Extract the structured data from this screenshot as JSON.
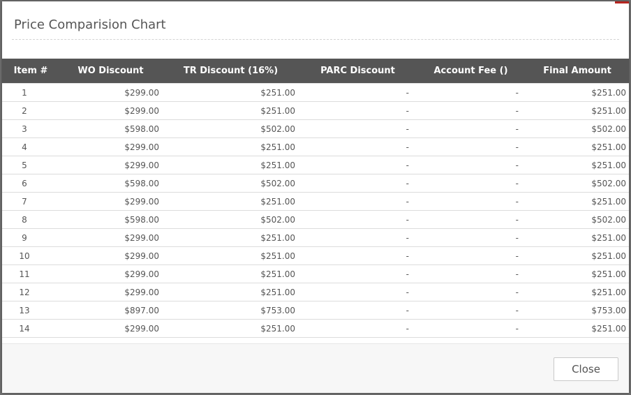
{
  "modal": {
    "title": "Price Comparision Chart",
    "close_label": "Close"
  },
  "table": {
    "headers": [
      "Item #",
      "WO Discount",
      "TR Discount (16%)",
      "PARC Discount",
      "Account Fee ()",
      "Final Amount"
    ],
    "rows": [
      [
        "1",
        "$299.00",
        "$251.00",
        "-",
        "-",
        "$251.00"
      ],
      [
        "2",
        "$299.00",
        "$251.00",
        "-",
        "-",
        "$251.00"
      ],
      [
        "3",
        "$598.00",
        "$502.00",
        "-",
        "-",
        "$502.00"
      ],
      [
        "4",
        "$299.00",
        "$251.00",
        "-",
        "-",
        "$251.00"
      ],
      [
        "5",
        "$299.00",
        "$251.00",
        "-",
        "-",
        "$251.00"
      ],
      [
        "6",
        "$598.00",
        "$502.00",
        "-",
        "-",
        "$502.00"
      ],
      [
        "7",
        "$299.00",
        "$251.00",
        "-",
        "-",
        "$251.00"
      ],
      [
        "8",
        "$598.00",
        "$502.00",
        "-",
        "-",
        "$502.00"
      ],
      [
        "9",
        "$299.00",
        "$251.00",
        "-",
        "-",
        "$251.00"
      ],
      [
        "10",
        "$299.00",
        "$251.00",
        "-",
        "-",
        "$251.00"
      ],
      [
        "11",
        "$299.00",
        "$251.00",
        "-",
        "-",
        "$251.00"
      ],
      [
        "12",
        "$299.00",
        "$251.00",
        "-",
        "-",
        "$251.00"
      ],
      [
        "13",
        "$897.00",
        "$753.00",
        "-",
        "-",
        "$753.00"
      ],
      [
        "14",
        "$299.00",
        "$251.00",
        "-",
        "-",
        "$251.00"
      ]
    ]
  }
}
